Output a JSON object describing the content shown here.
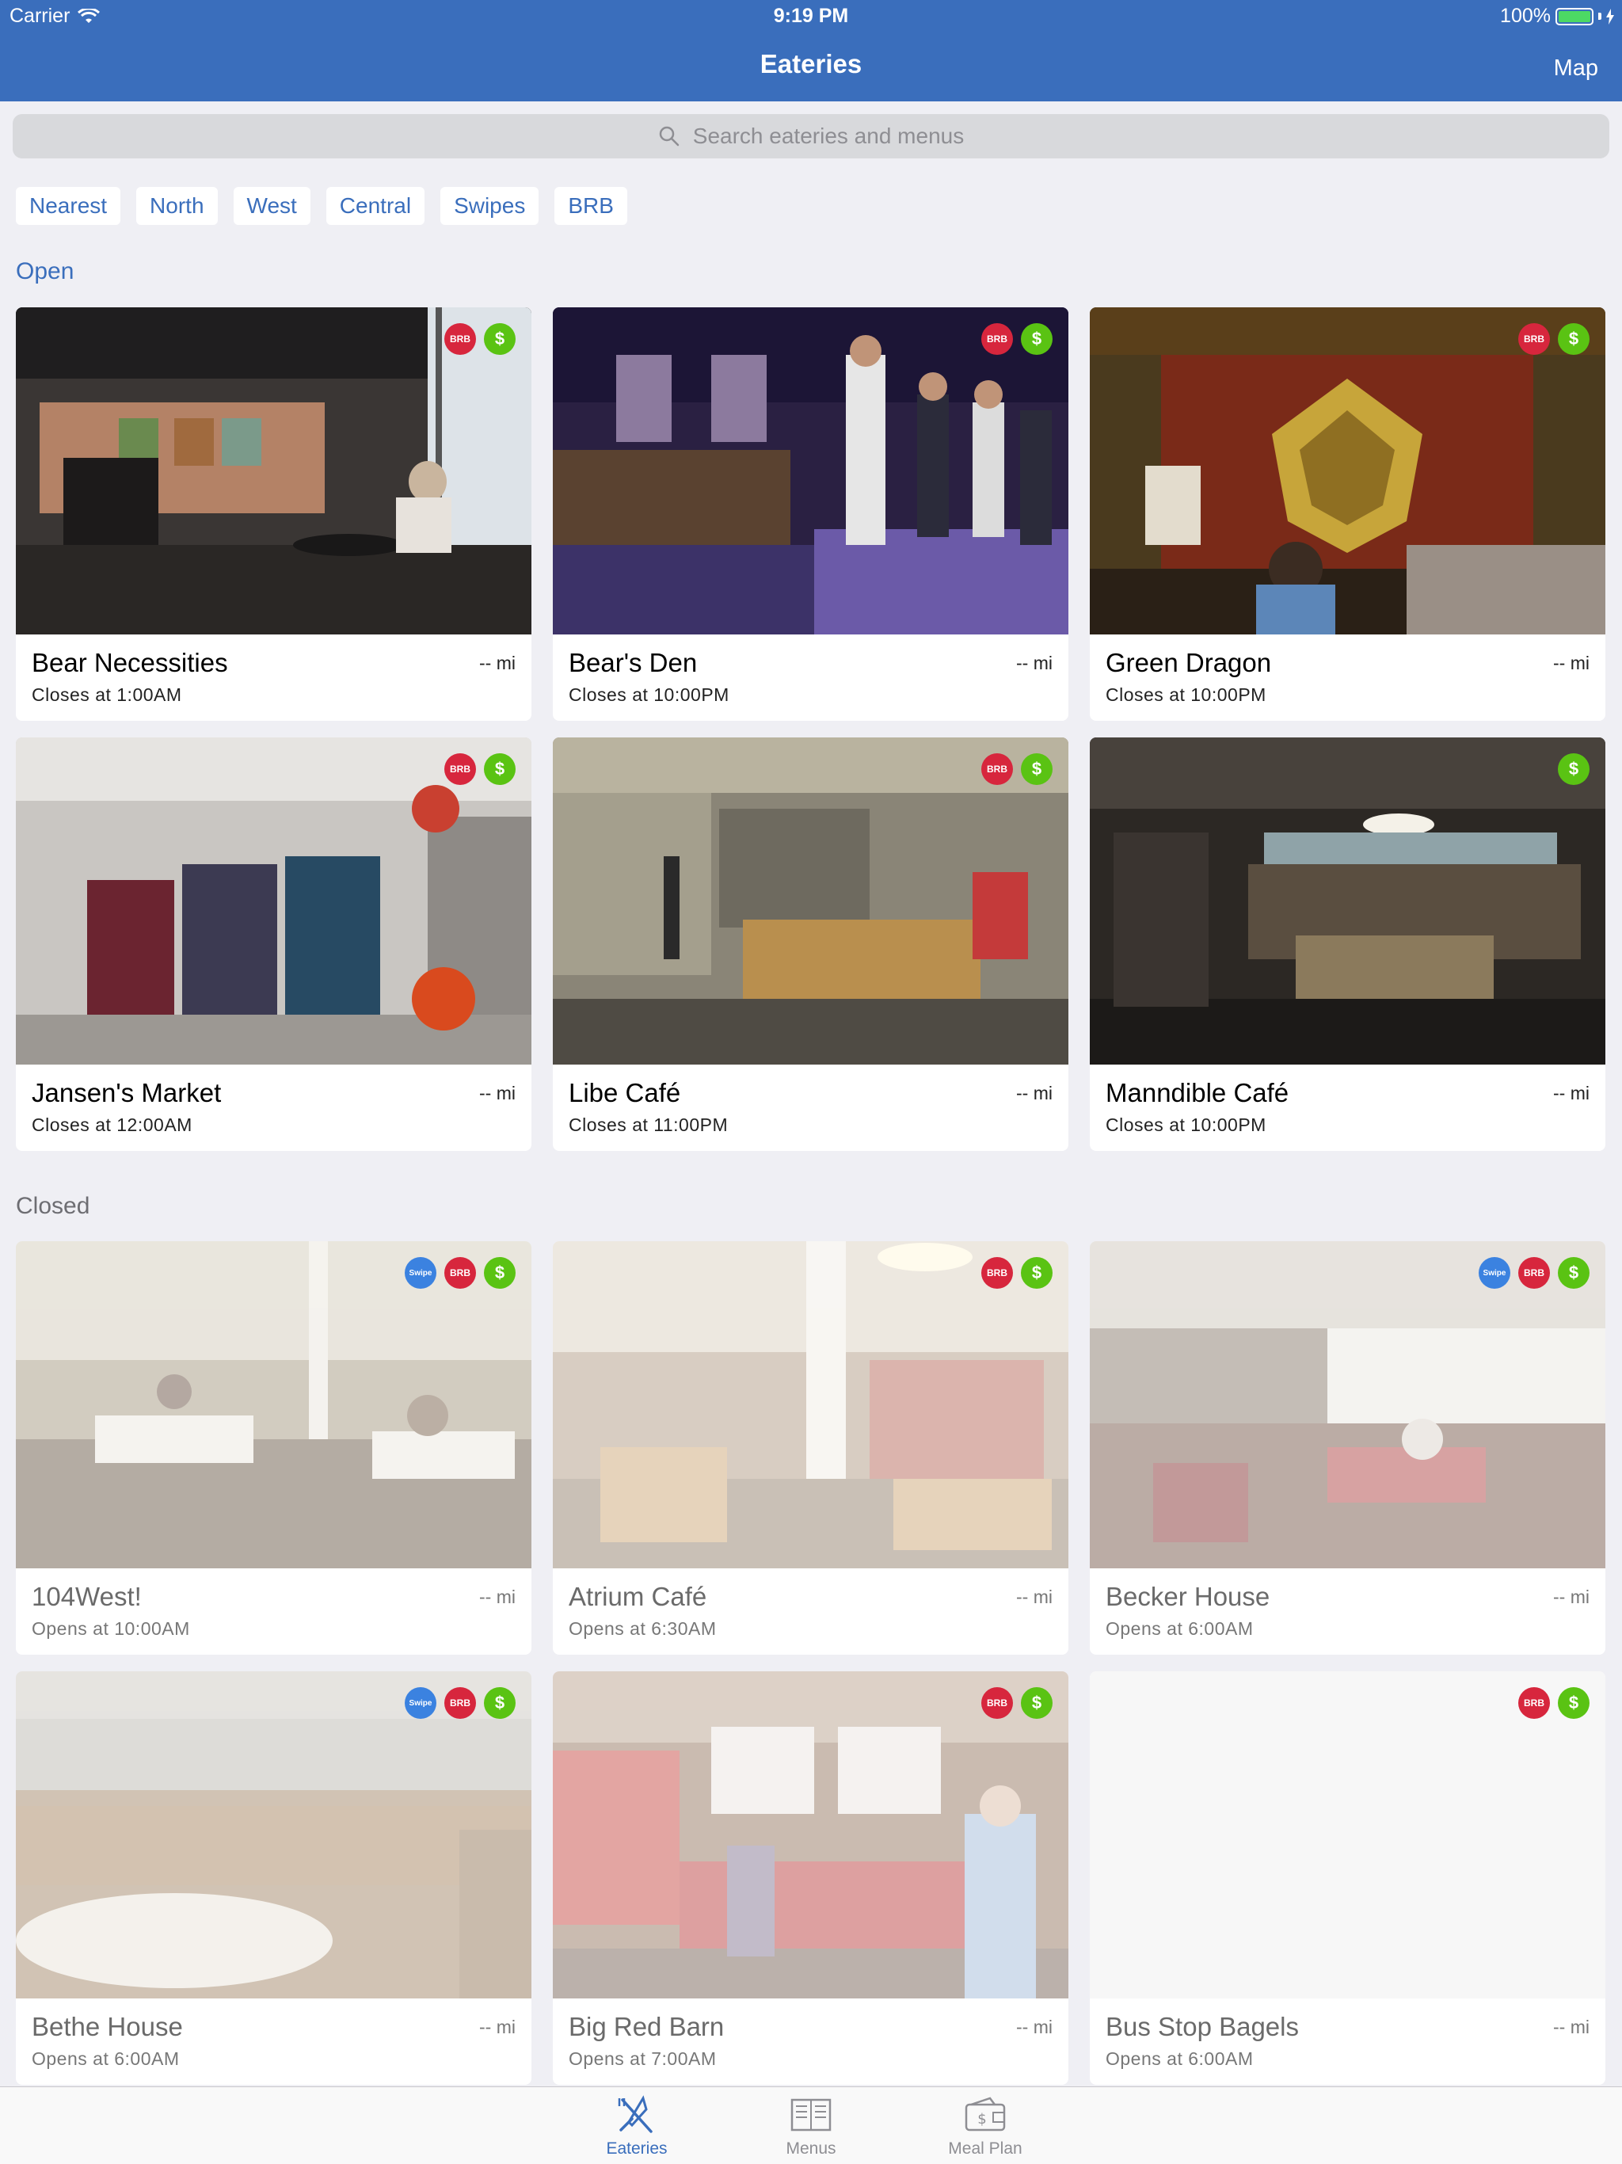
{
  "status_bar": {
    "carrier": "Carrier",
    "time": "9:19 PM",
    "battery": "100%"
  },
  "nav": {
    "title": "Eateries",
    "right_button": "Map"
  },
  "search": {
    "placeholder": "Search eateries and menus"
  },
  "filters": [
    "Nearest",
    "North",
    "West",
    "Central",
    "Swipes",
    "BRB"
  ],
  "sections": {
    "open": "Open",
    "closed": "Closed"
  },
  "badge_labels": {
    "brb": "BRB",
    "cash": "$",
    "swipe": "Swipe"
  },
  "open_eateries": [
    {
      "name": "Bear Necessities",
      "hours": "Closes at 1:00AM",
      "distance": "-- mi",
      "badges": [
        "brb",
        "cash"
      ]
    },
    {
      "name": "Bear's Den",
      "hours": "Closes at 10:00PM",
      "distance": "-- mi",
      "badges": [
        "brb",
        "cash"
      ]
    },
    {
      "name": "Green Dragon",
      "hours": "Closes at 10:00PM",
      "distance": "-- mi",
      "badges": [
        "brb",
        "cash"
      ]
    },
    {
      "name": "Jansen's Market",
      "hours": "Closes at 12:00AM",
      "distance": "-- mi",
      "badges": [
        "brb",
        "cash"
      ]
    },
    {
      "name": "Libe Café",
      "hours": "Closes at 11:00PM",
      "distance": "-- mi",
      "badges": [
        "brb",
        "cash"
      ]
    },
    {
      "name": "Manndible Café",
      "hours": "Closes at 10:00PM",
      "distance": "-- mi",
      "badges": [
        "cash"
      ]
    }
  ],
  "closed_eateries": [
    {
      "name": "104West!",
      "hours": "Opens at 10:00AM",
      "distance": "-- mi",
      "badges": [
        "swipe",
        "brb",
        "cash"
      ]
    },
    {
      "name": "Atrium Café",
      "hours": "Opens at 6:30AM",
      "distance": "-- mi",
      "badges": [
        "brb",
        "cash"
      ]
    },
    {
      "name": "Becker House",
      "hours": "Opens at 6:00AM",
      "distance": "-- mi",
      "badges": [
        "swipe",
        "brb",
        "cash"
      ]
    },
    {
      "name": "Bethe House",
      "hours": "Opens at 6:00AM",
      "distance": "-- mi",
      "badges": [
        "swipe",
        "brb",
        "cash"
      ]
    },
    {
      "name": "Big Red Barn",
      "hours": "Opens at 7:00AM",
      "distance": "-- mi",
      "badges": [
        "brb",
        "cash"
      ]
    },
    {
      "name": "Bus Stop Bagels",
      "hours": "Opens at 6:00AM",
      "distance": "-- mi",
      "badges": [
        "brb",
        "cash"
      ]
    }
  ],
  "tabs": [
    {
      "label": "Eateries",
      "icon": "fork-knife-icon",
      "active": true
    },
    {
      "label": "Menus",
      "icon": "menu-book-icon",
      "active": false
    },
    {
      "label": "Meal Plan",
      "icon": "wallet-icon",
      "active": false
    }
  ],
  "colors": {
    "brand": "#3a6ebc",
    "brb": "#d7263d",
    "cash": "#5ac313",
    "swipe": "#3b82e0"
  }
}
